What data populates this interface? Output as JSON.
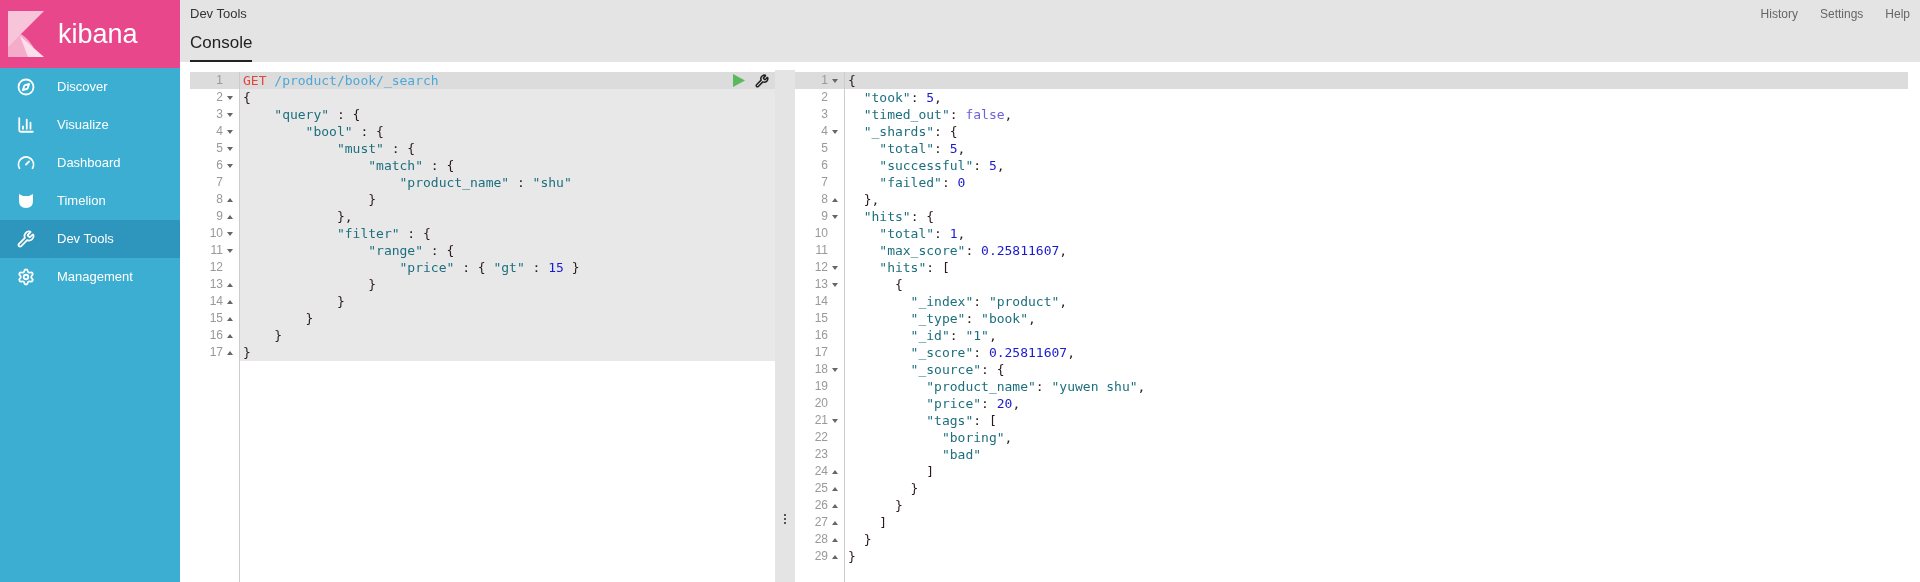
{
  "sidebar": {
    "logo_text": "kibana",
    "items": [
      {
        "label": "Discover",
        "kind": "compass",
        "selected": false
      },
      {
        "label": "Visualize",
        "kind": "chart",
        "selected": false
      },
      {
        "label": "Dashboard",
        "kind": "gauge",
        "selected": false
      },
      {
        "label": "Timelion",
        "kind": "animal",
        "selected": false
      },
      {
        "label": "Dev Tools",
        "kind": "wrench",
        "selected": true
      },
      {
        "label": "Management",
        "kind": "gear",
        "selected": false
      }
    ]
  },
  "header": {
    "breadcrumb": "Dev Tools",
    "links": [
      "History",
      "Settings",
      "Help"
    ]
  },
  "tabs": [
    {
      "label": "Console",
      "selected": true
    }
  ],
  "request_editor": {
    "lines": [
      {
        "number": "1",
        "kind": "plain",
        "active": true,
        "t": [
          {
            "kind": "method",
            "text": "GET "
          },
          {
            "kind": "url",
            "text": "/product/book/_search"
          }
        ]
      },
      {
        "number": "2",
        "kind": "fold_start",
        "active": false,
        "t": [
          {
            "kind": "punct",
            "text": "{"
          }
        ]
      },
      {
        "number": "3",
        "kind": "fold_start",
        "active": false,
        "t": [
          {
            "kind": "string",
            "text": "    \"query\""
          },
          {
            "kind": "punct",
            "text": " : {"
          }
        ]
      },
      {
        "number": "4",
        "kind": "fold_start",
        "active": false,
        "t": [
          {
            "kind": "string",
            "text": "        \"bool\""
          },
          {
            "kind": "punct",
            "text": " : {"
          }
        ]
      },
      {
        "number": "5",
        "kind": "fold_start",
        "active": false,
        "t": [
          {
            "kind": "string",
            "text": "            \"must\""
          },
          {
            "kind": "punct",
            "text": " : {"
          }
        ]
      },
      {
        "number": "6",
        "kind": "fold_start",
        "active": false,
        "t": [
          {
            "kind": "string",
            "text": "                \"match\""
          },
          {
            "kind": "punct",
            "text": " : {"
          }
        ]
      },
      {
        "number": "7",
        "kind": "plain",
        "active": false,
        "t": [
          {
            "kind": "string",
            "text": "                    \"product_name\""
          },
          {
            "kind": "punct",
            "text": " : "
          },
          {
            "kind": "string",
            "text": "\"shu\""
          }
        ]
      },
      {
        "number": "8",
        "kind": "fold_end",
        "active": false,
        "t": [
          {
            "kind": "punct",
            "text": "                }"
          }
        ]
      },
      {
        "number": "9",
        "kind": "fold_end",
        "active": false,
        "t": [
          {
            "kind": "punct",
            "text": "            },"
          }
        ]
      },
      {
        "number": "10",
        "kind": "fold_start",
        "active": false,
        "t": [
          {
            "kind": "string",
            "text": "            \"filter\""
          },
          {
            "kind": "punct",
            "text": " : {"
          }
        ]
      },
      {
        "number": "11",
        "kind": "fold_start",
        "active": false,
        "t": [
          {
            "kind": "string",
            "text": "                \"range\""
          },
          {
            "kind": "punct",
            "text": " : {"
          }
        ]
      },
      {
        "number": "12",
        "kind": "plain",
        "active": false,
        "t": [
          {
            "kind": "string",
            "text": "                    \"price\""
          },
          {
            "kind": "punct",
            "text": " : { "
          },
          {
            "kind": "string",
            "text": "\"gt\""
          },
          {
            "kind": "punct",
            "text": " : "
          },
          {
            "kind": "number",
            "text": "15"
          },
          {
            "kind": "punct",
            "text": " }"
          }
        ]
      },
      {
        "number": "13",
        "kind": "fold_end",
        "active": false,
        "t": [
          {
            "kind": "punct",
            "text": "                }"
          }
        ]
      },
      {
        "number": "14",
        "kind": "fold_end",
        "active": false,
        "t": [
          {
            "kind": "punct",
            "text": "            }"
          }
        ]
      },
      {
        "number": "15",
        "kind": "fold_end",
        "active": false,
        "t": [
          {
            "kind": "punct",
            "text": "        }"
          }
        ]
      },
      {
        "number": "16",
        "kind": "fold_end",
        "active": false,
        "t": [
          {
            "kind": "punct",
            "text": "    }"
          }
        ]
      },
      {
        "number": "17",
        "kind": "fold_end",
        "active": false,
        "t": [
          {
            "kind": "punct",
            "text": "}"
          }
        ]
      }
    ]
  },
  "response_editor": {
    "lines": [
      {
        "number": "1",
        "kind": "fold_start",
        "active": true,
        "t": [
          {
            "kind": "punct",
            "text": "{"
          }
        ]
      },
      {
        "number": "2",
        "kind": "plain",
        "active": false,
        "t": [
          {
            "kind": "string",
            "text": "  \"took\""
          },
          {
            "kind": "punct",
            "text": ": "
          },
          {
            "kind": "number",
            "text": "5"
          },
          {
            "kind": "punct",
            "text": ","
          }
        ]
      },
      {
        "number": "3",
        "kind": "plain",
        "active": false,
        "t": [
          {
            "kind": "string",
            "text": "  \"timed_out\""
          },
          {
            "kind": "punct",
            "text": ": "
          },
          {
            "kind": "boolean",
            "text": "false"
          },
          {
            "kind": "punct",
            "text": ","
          }
        ]
      },
      {
        "number": "4",
        "kind": "fold_start",
        "active": false,
        "t": [
          {
            "kind": "string",
            "text": "  \"_shards\""
          },
          {
            "kind": "punct",
            "text": ": {"
          }
        ]
      },
      {
        "number": "5",
        "kind": "plain",
        "active": false,
        "t": [
          {
            "kind": "string",
            "text": "    \"total\""
          },
          {
            "kind": "punct",
            "text": ": "
          },
          {
            "kind": "number",
            "text": "5"
          },
          {
            "kind": "punct",
            "text": ","
          }
        ]
      },
      {
        "number": "6",
        "kind": "plain",
        "active": false,
        "t": [
          {
            "kind": "string",
            "text": "    \"successful\""
          },
          {
            "kind": "punct",
            "text": ": "
          },
          {
            "kind": "number",
            "text": "5"
          },
          {
            "kind": "punct",
            "text": ","
          }
        ]
      },
      {
        "number": "7",
        "kind": "plain",
        "active": false,
        "t": [
          {
            "kind": "string",
            "text": "    \"failed\""
          },
          {
            "kind": "punct",
            "text": ": "
          },
          {
            "kind": "number",
            "text": "0"
          }
        ]
      },
      {
        "number": "8",
        "kind": "fold_end",
        "active": false,
        "t": [
          {
            "kind": "punct",
            "text": "  },"
          }
        ]
      },
      {
        "number": "9",
        "kind": "fold_start",
        "active": false,
        "t": [
          {
            "kind": "string",
            "text": "  \"hits\""
          },
          {
            "kind": "punct",
            "text": ": {"
          }
        ]
      },
      {
        "number": "10",
        "kind": "plain",
        "active": false,
        "t": [
          {
            "kind": "string",
            "text": "    \"total\""
          },
          {
            "kind": "punct",
            "text": ": "
          },
          {
            "kind": "number",
            "text": "1"
          },
          {
            "kind": "punct",
            "text": ","
          }
        ]
      },
      {
        "number": "11",
        "kind": "plain",
        "active": false,
        "t": [
          {
            "kind": "string",
            "text": "    \"max_score\""
          },
          {
            "kind": "punct",
            "text": ": "
          },
          {
            "kind": "number",
            "text": "0.25811607"
          },
          {
            "kind": "punct",
            "text": ","
          }
        ]
      },
      {
        "number": "12",
        "kind": "fold_start",
        "active": false,
        "t": [
          {
            "kind": "string",
            "text": "    \"hits\""
          },
          {
            "kind": "punct",
            "text": ": ["
          }
        ]
      },
      {
        "number": "13",
        "kind": "fold_start",
        "active": false,
        "t": [
          {
            "kind": "punct",
            "text": "      {"
          }
        ]
      },
      {
        "number": "14",
        "kind": "plain",
        "active": false,
        "t": [
          {
            "kind": "string",
            "text": "        \"_index\""
          },
          {
            "kind": "punct",
            "text": ": "
          },
          {
            "kind": "string",
            "text": "\"product\""
          },
          {
            "kind": "punct",
            "text": ","
          }
        ]
      },
      {
        "number": "15",
        "kind": "plain",
        "active": false,
        "t": [
          {
            "kind": "string",
            "text": "        \"_type\""
          },
          {
            "kind": "punct",
            "text": ": "
          },
          {
            "kind": "string",
            "text": "\"book\""
          },
          {
            "kind": "punct",
            "text": ","
          }
        ]
      },
      {
        "number": "16",
        "kind": "plain",
        "active": false,
        "t": [
          {
            "kind": "string",
            "text": "        \"_id\""
          },
          {
            "kind": "punct",
            "text": ": "
          },
          {
            "kind": "string",
            "text": "\"1\""
          },
          {
            "kind": "punct",
            "text": ","
          }
        ]
      },
      {
        "number": "17",
        "kind": "plain",
        "active": false,
        "t": [
          {
            "kind": "string",
            "text": "        \"_score\""
          },
          {
            "kind": "punct",
            "text": ": "
          },
          {
            "kind": "number",
            "text": "0.25811607"
          },
          {
            "kind": "punct",
            "text": ","
          }
        ]
      },
      {
        "number": "18",
        "kind": "fold_start",
        "active": false,
        "t": [
          {
            "kind": "string",
            "text": "        \"_source\""
          },
          {
            "kind": "punct",
            "text": ": {"
          }
        ]
      },
      {
        "number": "19",
        "kind": "plain",
        "active": false,
        "t": [
          {
            "kind": "string",
            "text": "          \"product_name\""
          },
          {
            "kind": "punct",
            "text": ": "
          },
          {
            "kind": "string",
            "text": "\"yuwen shu\""
          },
          {
            "kind": "punct",
            "text": ","
          }
        ]
      },
      {
        "number": "20",
        "kind": "plain",
        "active": false,
        "t": [
          {
            "kind": "string",
            "text": "          \"price\""
          },
          {
            "kind": "punct",
            "text": ": "
          },
          {
            "kind": "number",
            "text": "20"
          },
          {
            "kind": "punct",
            "text": ","
          }
        ]
      },
      {
        "number": "21",
        "kind": "fold_start",
        "active": false,
        "t": [
          {
            "kind": "string",
            "text": "          \"tags\""
          },
          {
            "kind": "punct",
            "text": ": ["
          }
        ]
      },
      {
        "number": "22",
        "kind": "plain",
        "active": false,
        "t": [
          {
            "kind": "string",
            "text": "            \"boring\""
          },
          {
            "kind": "punct",
            "text": ","
          }
        ]
      },
      {
        "number": "23",
        "kind": "plain",
        "active": false,
        "t": [
          {
            "kind": "string",
            "text": "            \"bad\""
          }
        ]
      },
      {
        "number": "24",
        "kind": "fold_end",
        "active": false,
        "t": [
          {
            "kind": "punct",
            "text": "          ]"
          }
        ]
      },
      {
        "number": "25",
        "kind": "fold_end",
        "active": false,
        "t": [
          {
            "kind": "punct",
            "text": "        }"
          }
        ]
      },
      {
        "number": "26",
        "kind": "fold_end",
        "active": false,
        "t": [
          {
            "kind": "punct",
            "text": "      }"
          }
        ]
      },
      {
        "number": "27",
        "kind": "fold_end",
        "active": false,
        "t": [
          {
            "kind": "punct",
            "text": "    ]"
          }
        ]
      },
      {
        "number": "28",
        "kind": "fold_end",
        "active": false,
        "t": [
          {
            "kind": "punct",
            "text": "  }"
          }
        ]
      },
      {
        "number": "29",
        "kind": "fold_end",
        "active": false,
        "t": [
          {
            "kind": "punct",
            "text": "}"
          }
        ]
      }
    ]
  }
}
